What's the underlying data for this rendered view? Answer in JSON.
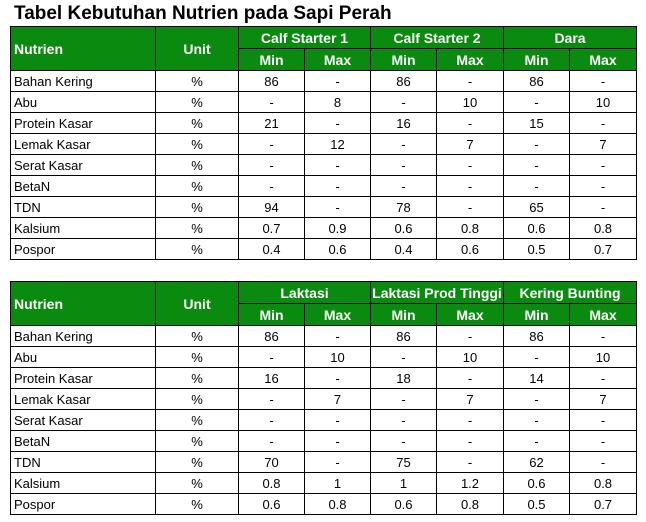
{
  "title": "Tabel Kebutuhan Nutrien pada Sapi Perah",
  "tables": [
    {
      "col_nutrien": "Nutrien",
      "col_unit": "Unit",
      "groups": [
        "Calf Starter 1",
        "Calf Starter 2",
        "Dara"
      ],
      "sub": [
        "Min",
        "Max",
        "Min",
        "Max",
        "Min",
        "Max"
      ],
      "rows": [
        {
          "name": "Bahan Kering",
          "unit": "%",
          "cells": [
            "86",
            "-",
            "86",
            "-",
            "86",
            "-"
          ]
        },
        {
          "name": "Abu",
          "unit": "%",
          "cells": [
            "-",
            "8",
            "-",
            "10",
            "-",
            "10"
          ]
        },
        {
          "name": "Protein Kasar",
          "unit": "%",
          "cells": [
            "21",
            "-",
            "16",
            "-",
            "15",
            "-"
          ]
        },
        {
          "name": "Lemak Kasar",
          "unit": "%",
          "cells": [
            "-",
            "12",
            "-",
            "7",
            "-",
            "7"
          ]
        },
        {
          "name": "Serat Kasar",
          "unit": "%",
          "cells": [
            "-",
            "-",
            "-",
            "-",
            "-",
            "-"
          ]
        },
        {
          "name": "BetaN",
          "unit": "%",
          "cells": [
            "-",
            "-",
            "-",
            "-",
            "-",
            "-"
          ]
        },
        {
          "name": "TDN",
          "unit": "%",
          "cells": [
            "94",
            "-",
            "78",
            "-",
            "65",
            "-"
          ]
        },
        {
          "name": "Kalsium",
          "unit": "%",
          "cells": [
            "0.7",
            "0.9",
            "0.6",
            "0.8",
            "0.6",
            "0.8"
          ]
        },
        {
          "name": "Pospor",
          "unit": "%",
          "cells": [
            "0.4",
            "0.6",
            "0.4",
            "0.6",
            "0.5",
            "0.7"
          ]
        }
      ]
    },
    {
      "col_nutrien": "Nutrien",
      "col_unit": "Unit",
      "groups": [
        "Laktasi",
        "Laktasi Prod Tinggi",
        "Kering Bunting"
      ],
      "sub": [
        "Min",
        "Max",
        "Min",
        "Max",
        "Min",
        "Max"
      ],
      "rows": [
        {
          "name": "Bahan Kering",
          "unit": "%",
          "cells": [
            "86",
            "-",
            "86",
            "-",
            "86",
            "-"
          ]
        },
        {
          "name": "Abu",
          "unit": "%",
          "cells": [
            "-",
            "10",
            "-",
            "10",
            "-",
            "10"
          ]
        },
        {
          "name": "Protein Kasar",
          "unit": "%",
          "cells": [
            "16",
            "-",
            "18",
            "-",
            "14",
            "-"
          ]
        },
        {
          "name": "Lemak Kasar",
          "unit": "%",
          "cells": [
            "-",
            "7",
            "-",
            "7",
            "-",
            "7"
          ]
        },
        {
          "name": "Serat Kasar",
          "unit": "%",
          "cells": [
            "-",
            "-",
            "-",
            "-",
            "-",
            "-"
          ]
        },
        {
          "name": "BetaN",
          "unit": "%",
          "cells": [
            "-",
            "-",
            "-",
            "-",
            "-",
            "-"
          ]
        },
        {
          "name": "TDN",
          "unit": "%",
          "cells": [
            "70",
            "-",
            "75",
            "-",
            "62",
            "-"
          ]
        },
        {
          "name": "Kalsium",
          "unit": "%",
          "cells": [
            "0.8",
            "1",
            "1",
            "1.2",
            "0.6",
            "0.8"
          ]
        },
        {
          "name": "Pospor",
          "unit": "%",
          "cells": [
            "0.6",
            "0.8",
            "0.6",
            "0.8",
            "0.5",
            "0.7"
          ]
        }
      ]
    }
  ]
}
